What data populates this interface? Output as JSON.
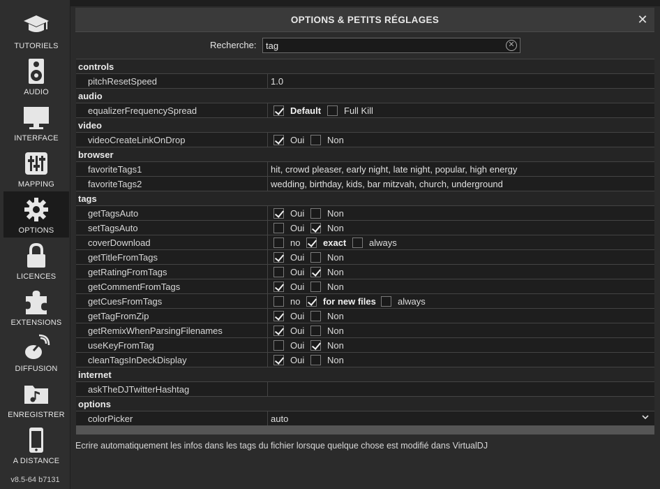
{
  "sidebar": {
    "items": [
      {
        "label": "TUTORIELS",
        "icon": "graduation-cap-icon"
      },
      {
        "label": "AUDIO",
        "icon": "speaker-icon"
      },
      {
        "label": "INTERFACE",
        "icon": "monitor-icon"
      },
      {
        "label": "MAPPING",
        "icon": "sliders-icon"
      },
      {
        "label": "OPTIONS",
        "icon": "gear-icon",
        "active": true
      },
      {
        "label": "LICENCES",
        "icon": "lock-icon"
      },
      {
        "label": "EXTENSIONS",
        "icon": "puzzle-icon"
      },
      {
        "label": "DIFFUSION",
        "icon": "broadcast-icon"
      },
      {
        "label": "ENREGISTRER",
        "icon": "music-folder-icon"
      },
      {
        "label": "A DISTANCE",
        "icon": "phone-icon"
      }
    ],
    "version": "v8.5-64 b7131"
  },
  "window": {
    "title": "OPTIONS & PETITS RÉGLAGES",
    "close": "✕"
  },
  "search": {
    "label": "Recherche:",
    "value": "tag",
    "clear": "✕"
  },
  "rows": {
    "s_controls": "controls",
    "pitchResetSpeed": {
      "key": "pitchResetSpeed",
      "value": "1.0"
    },
    "s_audio": "audio",
    "equalizerFrequencySpread": {
      "key": "equalizerFrequencySpread",
      "opt1": "Default",
      "opt2": "Full Kill"
    },
    "s_video": "video",
    "videoCreateLinkOnDrop": {
      "key": "videoCreateLinkOnDrop",
      "yes": "Oui",
      "no": "Non"
    },
    "s_browser": "browser",
    "favoriteTags1": {
      "key": "favoriteTags1",
      "value": "hit, crowd pleaser, early night, late night, popular, high energy"
    },
    "favoriteTags2": {
      "key": "favoriteTags2",
      "value": "wedding, birthday, kids, bar mitzvah, church, underground"
    },
    "s_tags": "tags",
    "getTagsAuto": {
      "key": "getTagsAuto",
      "yes": "Oui",
      "no": "Non"
    },
    "setTagsAuto": {
      "key": "setTagsAuto",
      "yes": "Oui",
      "no": "Non"
    },
    "coverDownload": {
      "key": "coverDownload",
      "o1": "no",
      "o2": "exact",
      "o3": "always"
    },
    "getTitleFromTags": {
      "key": "getTitleFromTags",
      "yes": "Oui",
      "no": "Non"
    },
    "getRatingFromTags": {
      "key": "getRatingFromTags",
      "yes": "Oui",
      "no": "Non"
    },
    "getCommentFromTags": {
      "key": "getCommentFromTags",
      "yes": "Oui",
      "no": "Non"
    },
    "getCuesFromTags": {
      "key": "getCuesFromTags",
      "o1": "no",
      "o2": "for new files",
      "o3": "always"
    },
    "getTagFromZip": {
      "key": "getTagFromZip",
      "yes": "Oui",
      "no": "Non"
    },
    "getRemixWhenParsingFilenames": {
      "key": "getRemixWhenParsingFilenames",
      "yes": "Oui",
      "no": "Non"
    },
    "useKeyFromTag": {
      "key": "useKeyFromTag",
      "yes": "Oui",
      "no": "Non"
    },
    "cleanTagsInDeckDisplay": {
      "key": "cleanTagsInDeckDisplay",
      "yes": "Oui",
      "no": "Non"
    },
    "s_internet": "internet",
    "askTheDJTwitterHashtag": {
      "key": "askTheDJTwitterHashtag",
      "value": ""
    },
    "s_options": "options",
    "colorPicker": {
      "key": "colorPicker",
      "value": "auto"
    }
  },
  "description": "Ecrire automatiquement les infos dans les tags du fichier lorsque quelque chose est modifié dans VirtualDJ"
}
